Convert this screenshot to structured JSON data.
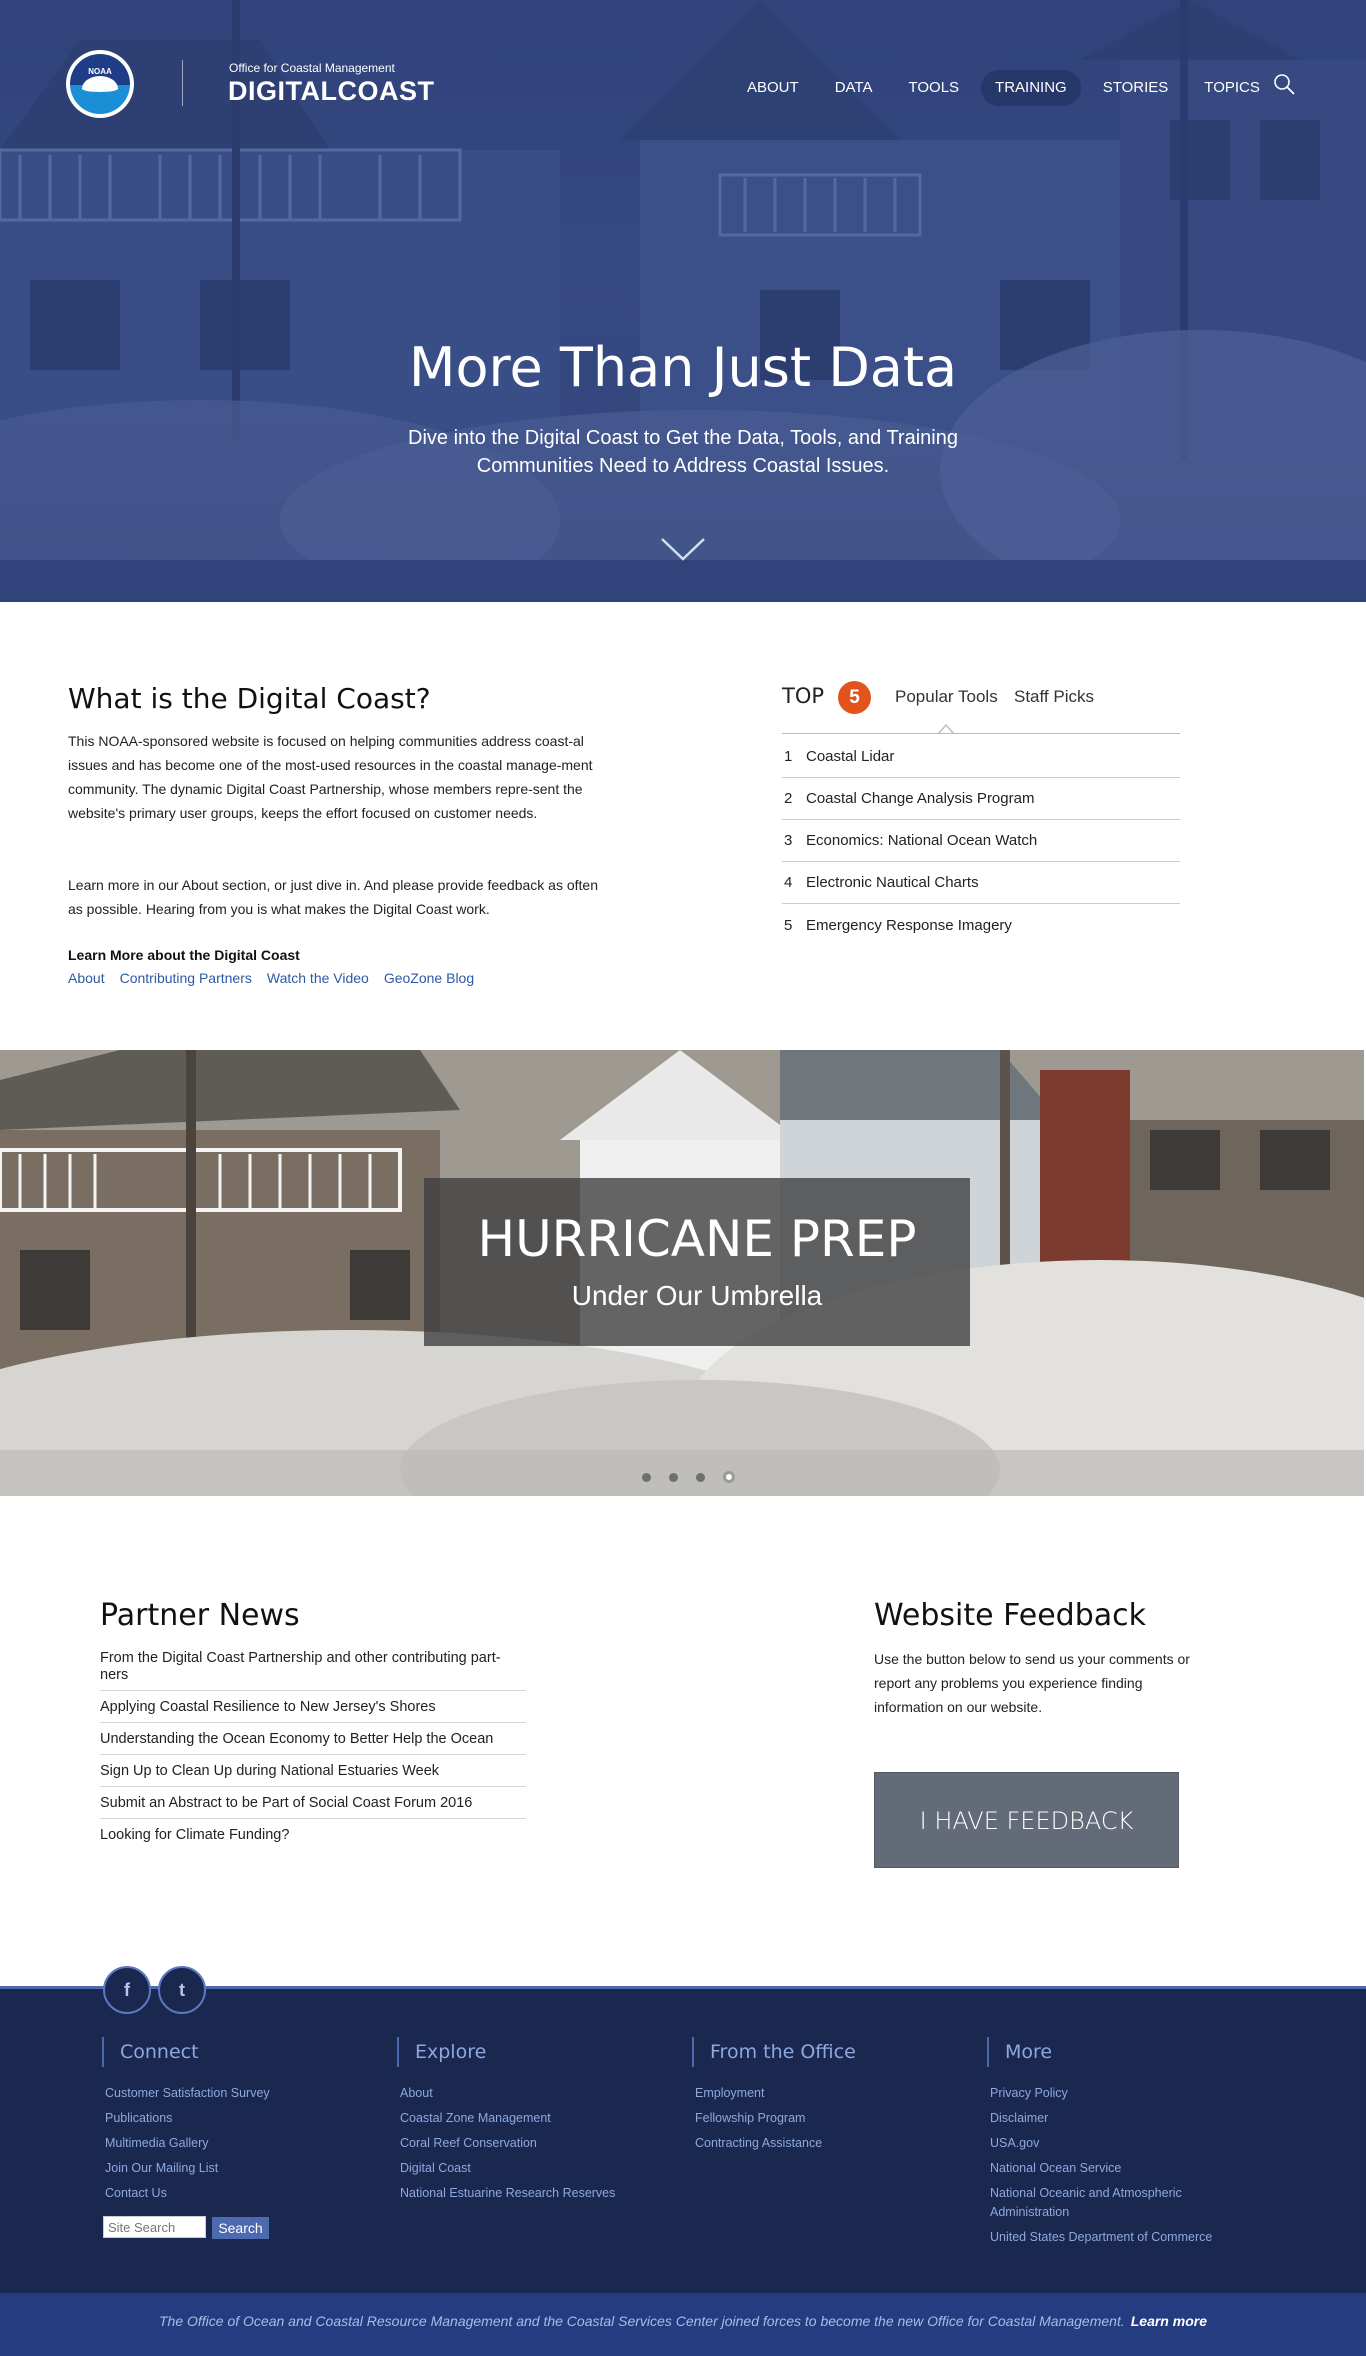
{
  "header": {
    "office": "Office for Coastal Management",
    "brand": "DIGITALCOAST",
    "logo_text": "NOAA",
    "nav": [
      {
        "label": "ABOUT"
      },
      {
        "label": "DATA"
      },
      {
        "label": "TOOLS"
      },
      {
        "label": "TRAINING"
      },
      {
        "label": "STORIES"
      },
      {
        "label": "TOPICS"
      }
    ]
  },
  "hero": {
    "title": "More Than Just Data",
    "subtitle": "Dive into the Digital Coast to Get the Data, Tools, and Training Communities Need to Address Coastal Issues."
  },
  "about": {
    "title": "What is the Digital Coast?",
    "paragraph1": "This NOAA-sponsored website is focused on helping communities address coast-al issues and has become one of the most-used resources in the coastal manage-ment community. The dynamic Digital Coast Partnership, whose members repre-sent the website's primary user groups, keeps the effort focused on customer needs.",
    "paragraph2": "Learn more in our About section, or just dive in. And please provide feedback as often as possible. Hearing from you is what makes the Digital Coast work.",
    "learn_more_heading": "Learn More about the Digital Coast",
    "links": [
      "About",
      "Contributing Partners",
      "Watch the Video",
      "GeoZone Blog"
    ]
  },
  "top5": {
    "label": "TOP",
    "badge": "5",
    "tabs": [
      "Popular Tools",
      "Staff Picks"
    ],
    "items": [
      {
        "num": "1",
        "label": "Coastal Lidar"
      },
      {
        "num": "2",
        "label": "Coastal Change Analysis Program"
      },
      {
        "num": "3",
        "label": "Economics: National Ocean Watch"
      },
      {
        "num": "4",
        "label": "Electronic Nautical Charts"
      },
      {
        "num": "5",
        "label": "Emergency Response Imagery"
      }
    ]
  },
  "banner": {
    "title": "HURRICANE PREP",
    "subtitle": "Under Our Umbrella",
    "slides": 4,
    "active_slide": 4
  },
  "partner_news": {
    "title": "Partner News",
    "items": [
      "From the Digital Coast Partnership and other contributing part-ners",
      "Applying Coastal Resilience to New Jersey's Shores",
      "Understanding the Ocean Economy to Better Help the Ocean",
      "Sign Up to Clean Up during National Estuaries Week",
      "Submit an Abstract to be Part of Social Coast Forum 2016",
      "Looking for Climate Funding?"
    ]
  },
  "feedback": {
    "title": "Website Feedback",
    "text": "Use the button below to send us your comments or report any problems you experience finding information on our website.",
    "button": "I HAVE FEEDBACK"
  },
  "footer": {
    "social": {
      "facebook": "f",
      "twitter": "t"
    },
    "connect": {
      "title": "Connect",
      "items": [
        "Customer Satisfaction Survey",
        "Publications",
        "Multimedia Gallery",
        "Join Our Mailing List",
        "Contact Us"
      ]
    },
    "explore": {
      "title": "Explore",
      "items": [
        "About",
        "Coastal Zone Management",
        "Coral Reef Conservation",
        "Digital Coast",
        "National Estuarine Research Reserves"
      ]
    },
    "office": {
      "title": "From the Office",
      "items": [
        "Employment",
        "Fellowship Program",
        "Contracting Assistance"
      ]
    },
    "more": {
      "title": "More",
      "items": [
        "Privacy Policy",
        "Disclaimer",
        "USA.gov",
        "National Ocean Service",
        "National Oceanic and Atmospheric Administration",
        "United States Department of Commerce"
      ]
    },
    "search_placeholder": "Site Search",
    "search_button": "Search",
    "bottom_text": "The Office of Ocean and Coastal Resource Management and the Coastal Services Center joined forces to become the new Office for Coastal Management.",
    "bottom_link": "Learn more"
  },
  "colors": {
    "hero_overlay": "#3b4f86",
    "badge": "#e2541c",
    "link": "#2d5aa6",
    "footer_bg": "#1a274f",
    "footer_link": "#8ea8dd",
    "bottom_bar": "#263c81",
    "feedback_button": "#646b78"
  }
}
